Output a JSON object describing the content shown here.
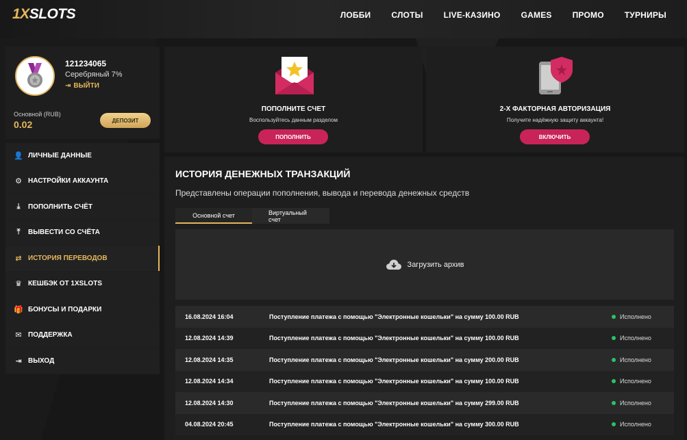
{
  "header": {
    "logo_accent": "1X",
    "logo_rest": "SLOTS",
    "nav": [
      "ЛОББИ",
      "СЛОТЫ",
      "LIVE-КАЗИНО",
      "GAMES",
      "ПРОМО",
      "ТУРНИРЫ"
    ]
  },
  "profile": {
    "user_id": "121234065",
    "level": "Серебряный 7%",
    "logout_label": "ВЫЙТИ",
    "balance_label": "Основной (RUB)",
    "balance_value": "0.02",
    "deposit_label": "ДЕПОЗИТ"
  },
  "menu": {
    "items": [
      {
        "label": "ЛИЧНЫЕ ДАННЫЕ",
        "icon": "user-plus-icon"
      },
      {
        "label": "НАСТРОЙКИ АККАУНТА",
        "icon": "gears-icon"
      },
      {
        "label": "ПОПОЛНИТЬ СЧЁТ",
        "icon": "download-icon"
      },
      {
        "label": "ВЫВЕСТИ СО СЧЁТА",
        "icon": "upload-icon"
      },
      {
        "label": "ИСТОРИЯ ПЕРЕВОДОВ",
        "icon": "exchange-icon"
      },
      {
        "label": "КЕШБЭК ОТ 1XSLOTS",
        "icon": "crown-icon"
      },
      {
        "label": "БОНУСЫ И ПОДАРКИ",
        "icon": "gift-icon"
      },
      {
        "label": "ПОДДЕРЖКА",
        "icon": "envelope-icon"
      },
      {
        "label": "ВЫХОД",
        "icon": "sign-out-icon"
      }
    ]
  },
  "promo": {
    "deposit": {
      "title": "ПОПОЛНИТЕ СЧЕТ",
      "subtitle": "Воспользуйтесь данным разделом",
      "button": "ПОПОЛНИТЬ"
    },
    "twofa": {
      "title": "2-Х ФАКТОРНАЯ АВТОРИЗАЦИЯ",
      "subtitle": "Получите надёжную защиту аккаунта!",
      "button": "ВКЛЮЧИТЬ"
    }
  },
  "history": {
    "title": "ИСТОРИЯ ДЕНЕЖНЫХ ТРАНЗАКЦИЙ",
    "subtitle": "Представлены операции пополнения, вывода и перевода денежных средств",
    "tabs": [
      "Основной счет",
      "Виртуальный счет"
    ],
    "archive_label": "Загрузить архив",
    "rows": [
      {
        "date": "16.08.2024 16:04",
        "desc": "Поступление платежа с помощью \"Электронные кошельки\" на сумму 100.00 RUB",
        "status": "Исполнено"
      },
      {
        "date": "12.08.2024 14:39",
        "desc": "Поступление платежа с помощью \"Электронные кошельки\" на сумму 100.00 RUB",
        "status": "Исполнено"
      },
      {
        "date": "12.08.2024 14:35",
        "desc": "Поступление платежа с помощью \"Электронные кошельки\" на сумму 200.00 RUB",
        "status": "Исполнено"
      },
      {
        "date": "12.08.2024 14:34",
        "desc": "Поступление платежа с помощью \"Электронные кошельки\" на сумму 100.00 RUB",
        "status": "Исполнено"
      },
      {
        "date": "12.08.2024 14:30",
        "desc": "Поступление платежа с помощью \"Электронные кошельки\" на сумму 299.00 RUB",
        "status": "Исполнено"
      },
      {
        "date": "04.08.2024 20:45",
        "desc": "Поступление платежа с помощью \"Электронные кошельки\" на сумму 300.00 RUB",
        "status": "Исполнено"
      }
    ]
  },
  "colors": {
    "accent": "#e5b75d",
    "pink": "#c8245a",
    "success": "#27c36a"
  }
}
